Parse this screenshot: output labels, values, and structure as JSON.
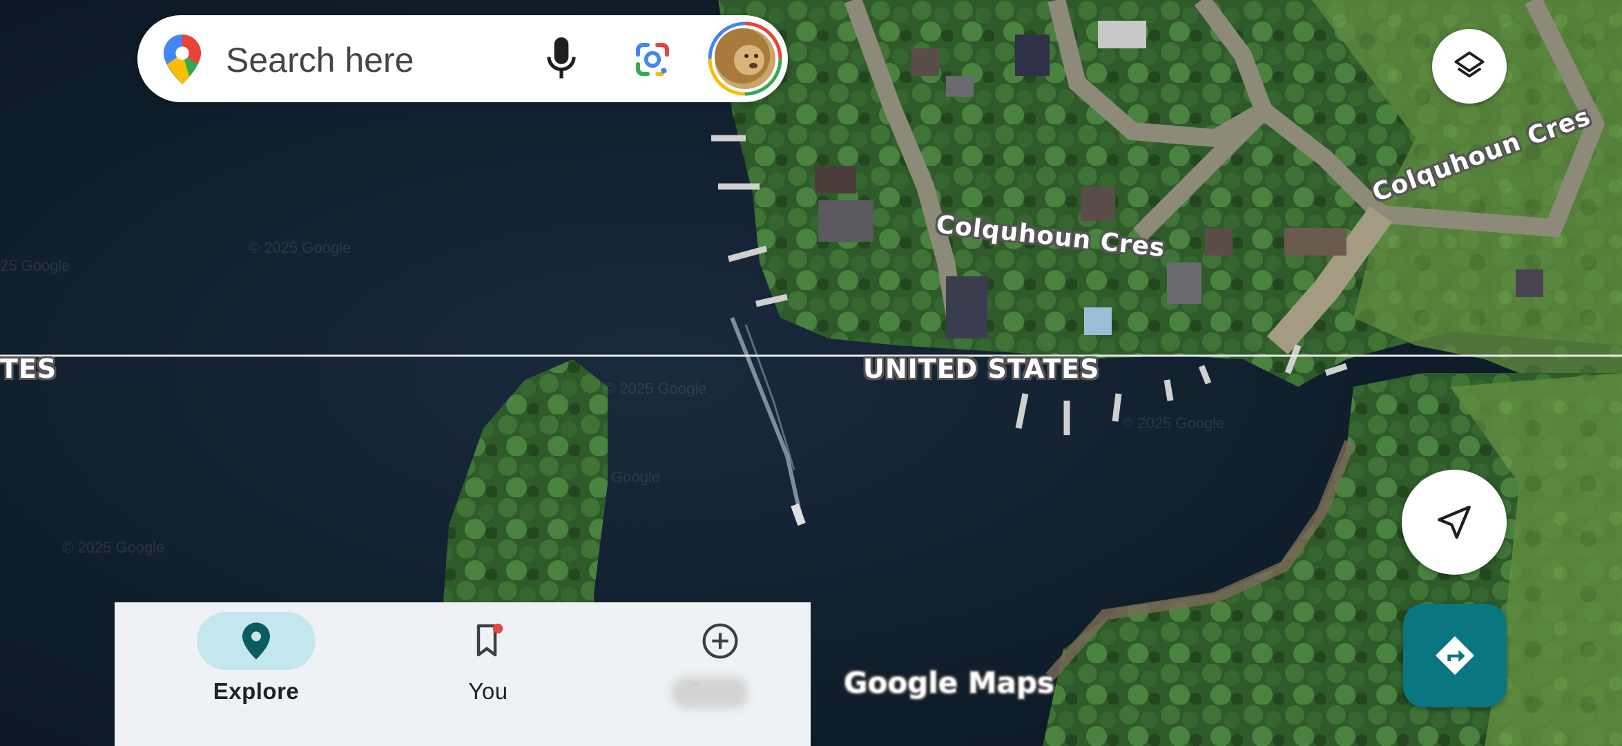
{
  "search": {
    "placeholder": "Search here"
  },
  "map": {
    "road_labels": [
      "Colquhoun Cres",
      "Colquhoun Cres"
    ],
    "border_labels": [
      "TES",
      "UNITED STATES"
    ],
    "watermarks": [
      "© 2025 Google",
      "25 Google",
      "© 2025 Google",
      "© 2025 Google",
      "Google",
      "© 2025 Google"
    ]
  },
  "nav": {
    "items": [
      {
        "label": "Explore",
        "icon": "location-pin-icon",
        "selected": true
      },
      {
        "label": "You",
        "icon": "bookmark-icon",
        "badge": true
      },
      {
        "label": "C",
        "icon": "add-circle-icon"
      }
    ]
  },
  "logo": {
    "text": "Google Maps"
  },
  "colors": {
    "accent": "#0a7680",
    "selected_pill": "#c4e7ef",
    "nav_bg": "#eef2f5",
    "badge": "#e8453c"
  }
}
